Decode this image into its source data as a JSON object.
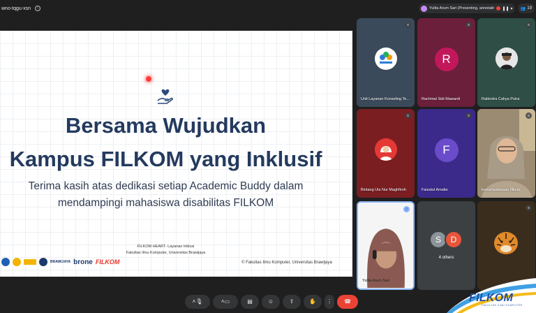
{
  "topbar": {
    "meeting_code": "wno-tqgu-xsn",
    "presenter_chip": "Yulita Arum Sari (Presenting, annotating)",
    "participants_count": "19"
  },
  "slide": {
    "title_line1": "Bersama Wujudkan",
    "title_line2": "Kampus FILKOM yang Inklusif",
    "subtitle_line1": "Terima kasih atas dedikasi setiap Academic Buddy dalam",
    "subtitle_line2": "mendampingi mahasiswa disabilitas FILKOM",
    "credit_line1": "FILKOM HEART- Layanan Inklusi",
    "credit_line2": "Fakultas Ilmu Komputer, Universitas Brawijaya",
    "copyright": "© Fakultas Ilmu Komputer, Universitas Brawijaya",
    "logos": {
      "ub_text": "BRAWIJAYA",
      "brone_text": "brone",
      "filkom_text": "FILKOM"
    }
  },
  "participants": [
    {
      "name": "Unit Layanan Konseling Te..."
    },
    {
      "name": "Rachmat Sidi Mawardi",
      "initial": "R"
    },
    {
      "name": "Rabindra Cahya Putra"
    },
    {
      "name": "Bintang Ula Nur Maghfiroh"
    },
    {
      "name": "Faizatul Amalia",
      "initial": "F"
    },
    {
      "name": "kemahasiswaan filkom"
    },
    {
      "name": "Yulita Arum Sari"
    },
    {
      "name": "4 others",
      "initials": [
        "S",
        "D"
      ]
    },
    {
      "name": ""
    }
  ],
  "corner_brand": {
    "text": "FILKOM",
    "sub": "FAKULTAS ILMU KOMPUTER"
  },
  "colors": {
    "background": "#1f1f1f",
    "tile_r": "#6b1f3a",
    "tile_f": "#3b2a8a",
    "avatar_r": "#c2185b",
    "avatar_f": "#6a4bc9",
    "hangup": "#ea4335",
    "title_navy": "#243a5e"
  }
}
